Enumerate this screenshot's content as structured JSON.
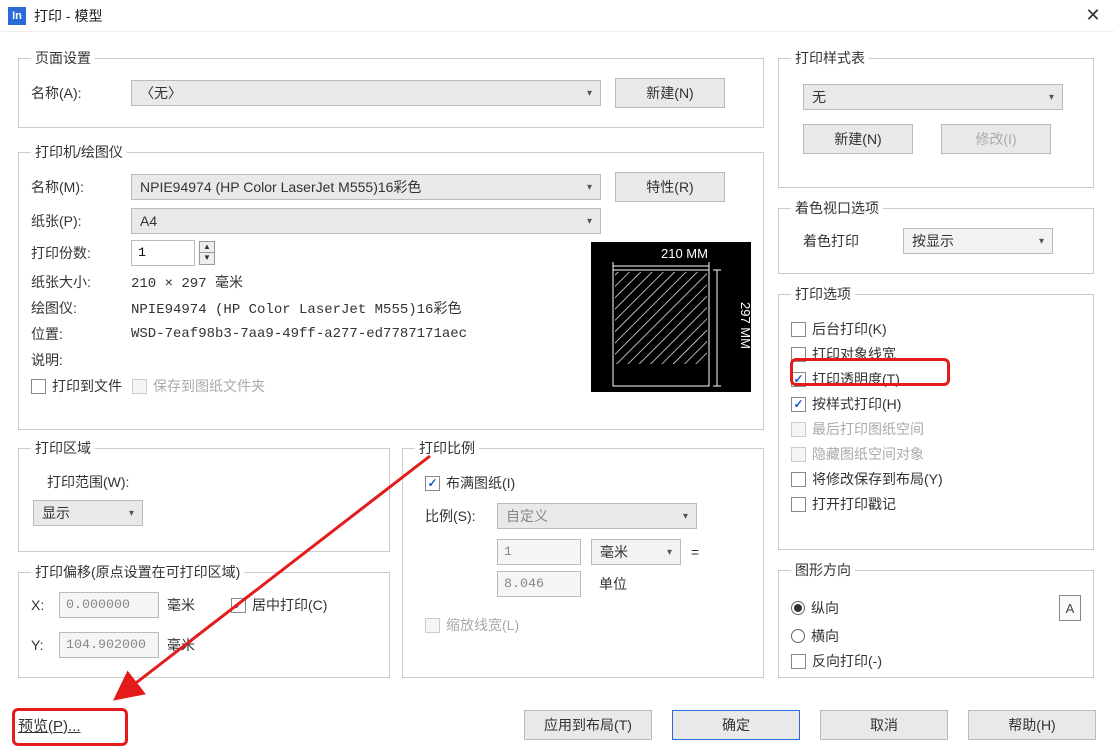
{
  "title": "打印 - 模型",
  "page_setup": {
    "legend": "页面设置",
    "name_label": "名称(A):",
    "name_value": "〈无〉",
    "new": "新建(N)"
  },
  "printer": {
    "legend": "打印机/绘图仪",
    "name_label": "名称(M):",
    "name_value": "NPIE94974 (HP Color LaserJet M555)16彩色",
    "properties": "特性(R)",
    "paper_label": "纸张(P):",
    "paper_value": "A4",
    "copies_label": "打印份数:",
    "copies_value": "1",
    "paper_size_label": "纸张大小:",
    "paper_size_value": "210 × 297  毫米",
    "plotter_label": "绘图仪:",
    "plotter_value": "NPIE94974 (HP Color LaserJet M555)16彩色",
    "location_label": "位置:",
    "location_value": "WSD-7eaf98b3-7aa9-49ff-a277-ed7787171aec",
    "desc_label": "说明:",
    "print_file": "打印到文件",
    "save_folder": "保存到图纸文件夹",
    "preview_w": "210 MM",
    "preview_h": "297 MM"
  },
  "area": {
    "legend": "打印区域",
    "range_label": "打印范围(W):",
    "range_value": "显示"
  },
  "offset": {
    "legend": "打印偏移(原点设置在可打印区域)",
    "x_label": "X:",
    "x_value": "0.000000",
    "x_unit": "毫米",
    "y_label": "Y:",
    "y_value": "104.902000",
    "y_unit": "毫米",
    "center": "居中打印(C)"
  },
  "scale": {
    "legend": "打印比例",
    "fit": "布满图纸(I)",
    "ratio_label": "比例(S):",
    "ratio_value": "自定义",
    "num_value": "1",
    "unit_sel": "毫米",
    "equals": "=",
    "den_value": "8.046",
    "unit_text": "单位",
    "lw": "缩放线宽(L)"
  },
  "style": {
    "legend": "打印样式表",
    "value": "无",
    "new": "新建(N)",
    "modify": "修改(I)"
  },
  "viewport": {
    "legend": "着色视口选项",
    "label": "着色打印",
    "value": "按显示"
  },
  "options": {
    "legend": "打印选项",
    "o1": "后台打印(K)",
    "o2": "打印对象线宽",
    "o3": "打印透明度(T)",
    "o4": "按样式打印(H)",
    "o5": "最后打印图纸空间",
    "o6": "隐藏图纸空间对象",
    "o7": "将修改保存到布局(Y)",
    "o8": "打开打印戳记"
  },
  "orient": {
    "legend": "图形方向",
    "r1": "纵向",
    "r2": "横向",
    "r3": "反向打印(-)",
    "icon": "A"
  },
  "bottom": {
    "preview": "预览(P)...",
    "apply": "应用到布局(T)",
    "ok": "确定",
    "cancel": "取消",
    "help": "帮助(H)"
  }
}
